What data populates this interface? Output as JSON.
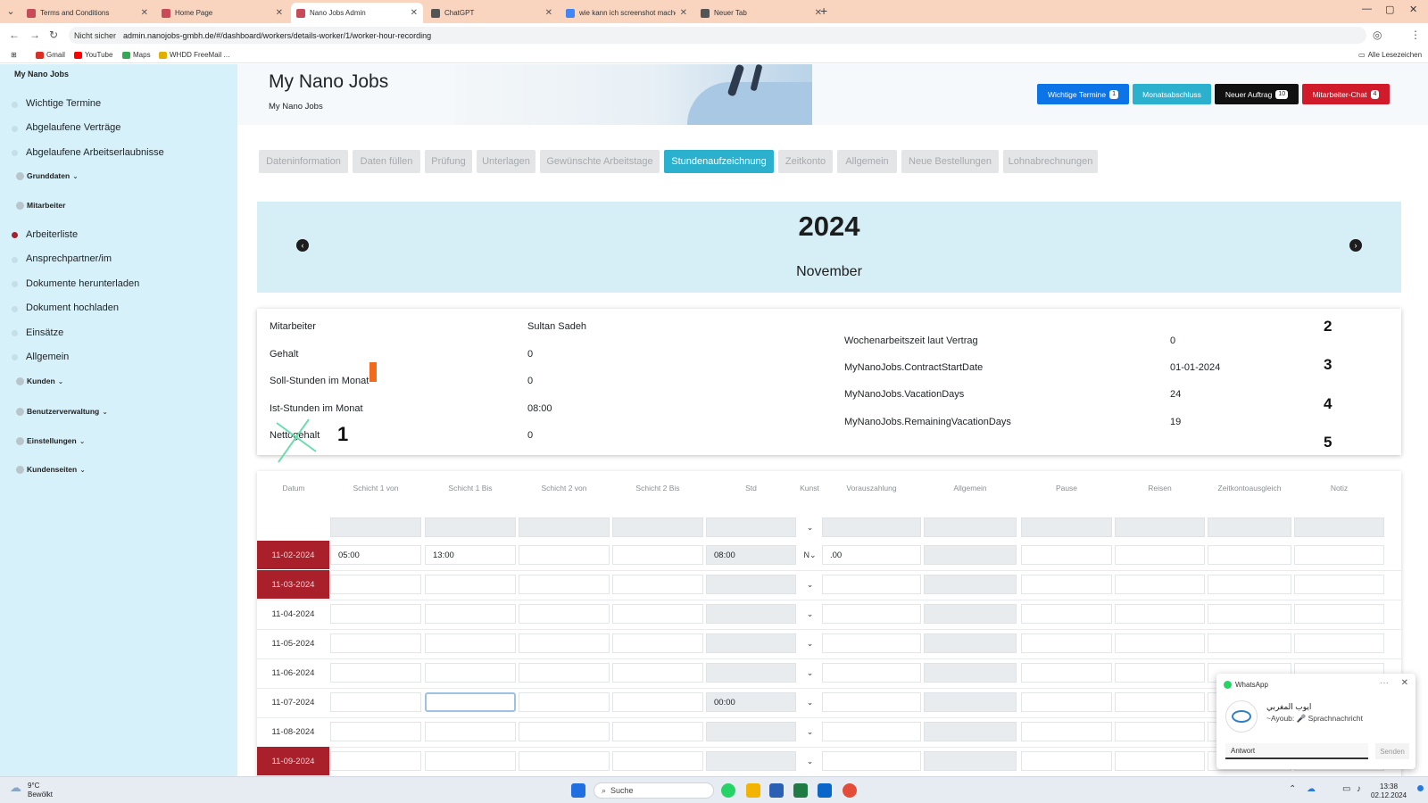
{
  "browser": {
    "tabs": [
      {
        "label": "Terms and Conditions",
        "favicon_color": "#c84b5a",
        "active": false
      },
      {
        "label": "Home Page",
        "favicon_color": "#c84b5a",
        "active": false
      },
      {
        "label": "Nano Jobs Admin",
        "favicon_color": "#c84b5a",
        "active": true
      },
      {
        "label": "ChatGPT",
        "favicon_color": "#555555",
        "active": false
      },
      {
        "label": "wie kann ich screenshot mache",
        "favicon_color": "#4285f4",
        "active": false
      },
      {
        "label": "Neuer Tab",
        "favicon_color": "#555555",
        "active": false
      }
    ],
    "security_label": "Nicht sicher",
    "url": "admin.nanojobs-gmbh.de/#/dashboard/workers/details-worker/1/worker-hour-recording",
    "bookmarks": [
      {
        "label": "Gmail",
        "color": "#d93025"
      },
      {
        "label": "YouTube",
        "color": "#ff0000"
      },
      {
        "label": "Maps",
        "color": "#34a853"
      },
      {
        "label": "WHDD FreeMail",
        "color": "#e0b000"
      },
      {
        "label": "…",
        "color": ""
      }
    ],
    "all_bookmarks_label": "Alle Lesezeichen"
  },
  "sidebar": {
    "brand": "My Nano Jobs",
    "items_top": [
      "Wichtige Termine",
      "Abgelaufene Verträge",
      "Abgelaufene Arbeitserlaubnisse"
    ],
    "group_grunddaten": "Grunddaten",
    "group_mitarbeiter": "Mitarbeiter",
    "items_mitarbeiter": [
      "Arbeiterliste",
      "Ansprechpartner/im",
      "Dokumente herunterladen",
      "Dokument hochladen",
      "Einsätze",
      "Allgemein"
    ],
    "group_kunden": "Kunden",
    "group_benutzer": "Benutzerverwaltung",
    "group_einstellungen": "Einstellungen",
    "group_kundenseiten": "Kundenseiten"
  },
  "header": {
    "title": "My Nano Jobs",
    "subtitle": "My Nano Jobs",
    "buttons": [
      {
        "label": "Wichtige Termine",
        "badge": "1",
        "color": "#0d74e8"
      },
      {
        "label": "Monatsabschluss",
        "badge": "",
        "color": "#2bb0cd"
      },
      {
        "label": "Neuer Auftrag",
        "badge": "10",
        "color": "#111111"
      },
      {
        "label": "Mitarbeiter-Chat",
        "badge": "4",
        "color": "#d11a2a"
      }
    ]
  },
  "page_tabs": [
    {
      "label": "Dateninformation",
      "active": false
    },
    {
      "label": "Daten füllen",
      "active": false
    },
    {
      "label": "Prüfung",
      "active": false
    },
    {
      "label": "Unterlagen",
      "active": false
    },
    {
      "label": "Gewünschte Arbeitstage",
      "active": false
    },
    {
      "label": "Stundenaufzeichnung",
      "active": true
    },
    {
      "label": "Zeitkonto",
      "active": false
    },
    {
      "label": "Allgemein",
      "active": false
    },
    {
      "label": "Neue Bestellungen",
      "active": false
    },
    {
      "label": "Lohnabrechnungen",
      "active": false
    }
  ],
  "period": {
    "year": "2024",
    "month": "November"
  },
  "info": {
    "left": [
      {
        "label": "Mitarbeiter",
        "value": "Sultan Sadeh"
      },
      {
        "label": "Gehalt",
        "value": "0"
      },
      {
        "label": "Soll-Stunden im Monat",
        "value": "0"
      },
      {
        "label": "Ist-Stunden im Monat",
        "value": "08:00"
      },
      {
        "label": "Nettogehalt",
        "value": "0"
      }
    ],
    "right": [
      {
        "label": "Wochenarbeitszeit laut Vertrag",
        "value": "0"
      },
      {
        "label": "MyNanoJobs.ContractStartDate",
        "value": "01-01-2024"
      },
      {
        "label": "MyNanoJobs.VacationDays",
        "value": "24"
      },
      {
        "label": "MyNanoJobs.RemainingVacationDays",
        "value": "19"
      }
    ],
    "annotations": [
      "1",
      "2",
      "3",
      "4",
      "5"
    ]
  },
  "grid": {
    "headers": [
      "Datum",
      "Schicht 1 von",
      "Schicht 1 Bis",
      "Schicht 2 von",
      "Schicht 2 Bis",
      "Std",
      "Kunst",
      "Vorauszahlung",
      "Allgemein",
      "Pause",
      "Reisen",
      "Zeitkontoausgleich",
      "Notiz"
    ],
    "rows": [
      {
        "date": "11-02-2024",
        "weekend": true,
        "s1_from": "05:00",
        "s1_to": "13:00",
        "std": "08:00",
        "kunst": "N",
        "advance": ".00"
      },
      {
        "date": "11-03-2024",
        "weekend": true,
        "s1_from": "",
        "s1_to": "",
        "std": "",
        "kunst": "",
        "advance": ""
      },
      {
        "date": "11-04-2024",
        "weekend": false,
        "s1_from": "",
        "s1_to": "",
        "std": "",
        "kunst": "",
        "advance": ""
      },
      {
        "date": "11-05-2024",
        "weekend": false,
        "s1_from": "",
        "s1_to": "",
        "std": "",
        "kunst": "",
        "advance": ""
      },
      {
        "date": "11-06-2024",
        "weekend": false,
        "s1_from": "",
        "s1_to": "",
        "std": "",
        "kunst": "",
        "advance": ""
      },
      {
        "date": "11-07-2024",
        "weekend": false,
        "s1_from": "",
        "s1_to": "",
        "std": "00:00",
        "kunst": "",
        "advance": ""
      },
      {
        "date": "11-08-2024",
        "weekend": false,
        "s1_from": "",
        "s1_to": "",
        "std": "",
        "kunst": "",
        "advance": ""
      },
      {
        "date": "11-09-2024",
        "weekend": true,
        "s1_from": "",
        "s1_to": "",
        "std": "",
        "kunst": "",
        "advance": ""
      }
    ]
  },
  "whatsapp": {
    "app": "WhatsApp",
    "sender": "ايوب المغربي",
    "message": "~Ayoub: 🎤 Sprachnachricht",
    "reply_placeholder": "Antwort",
    "send_label": "Senden"
  },
  "taskbar": {
    "temperature": "9°C",
    "weather": "Bewölkt",
    "search_placeholder": "Suche",
    "time": "13:38",
    "date": "02.12.2024"
  }
}
